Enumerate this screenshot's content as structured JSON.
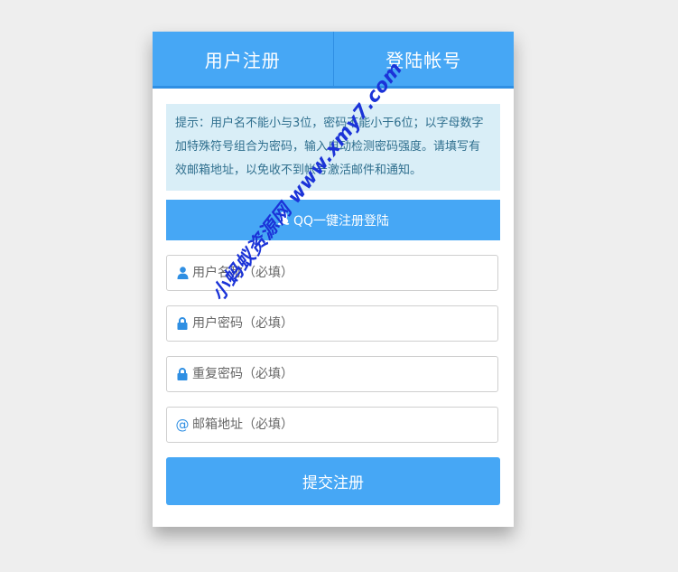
{
  "tabs": [
    {
      "label": "用户注册"
    },
    {
      "label": "登陆帐号"
    }
  ],
  "notice": {
    "text": "提示：用户名不能小与3位，密码不能小于6位；以字母数字加特殊符号组合为密码，输入自动检测密码强度。请填写有效邮箱地址，以免收不到帐号激活邮件和通知。"
  },
  "qq_button": {
    "label": "QQ一键注册登陆"
  },
  "fields": {
    "username": {
      "placeholder": "用户名称（必填）",
      "value": ""
    },
    "password": {
      "placeholder": "用户密码（必填）",
      "value": ""
    },
    "confirm": {
      "placeholder": "重复密码（必填）",
      "value": ""
    },
    "email": {
      "placeholder": "邮箱地址（必填）",
      "value": ""
    }
  },
  "submit": {
    "label": "提交注册"
  },
  "watermark": {
    "text": "小蚂蚁资源网 www.xmy7.com"
  },
  "colors": {
    "primary": "#46a7f5",
    "primary_dark": "#2f8fe3",
    "notice_bg": "#d9eef7",
    "notice_text": "#2f6f8e",
    "watermark": "#1b33d8"
  },
  "icons": {
    "username": "user-icon",
    "password": "lock-icon",
    "confirm": "lock-icon",
    "email": "at-icon",
    "qq": "qq-penguin-icon"
  }
}
